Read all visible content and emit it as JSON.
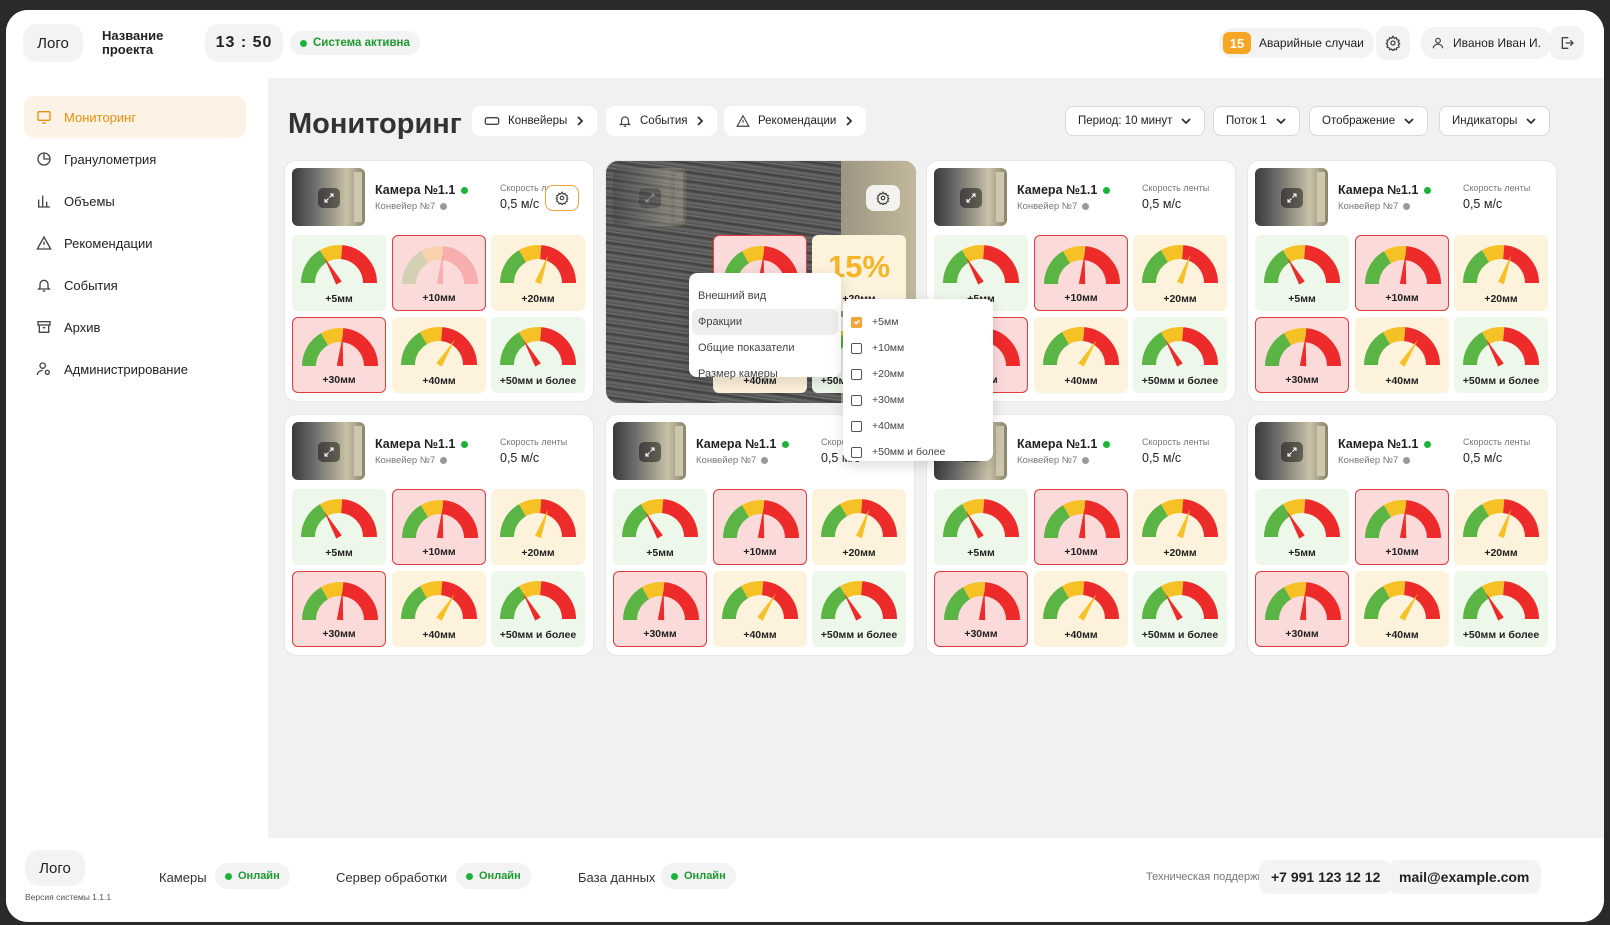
{
  "header": {
    "logo": "Лого",
    "project_name": "Название проекта",
    "clock": "13 : 50",
    "system_status": "Система активна",
    "alarm_count": "15",
    "alarm_label": "Аварийные случаи",
    "user_name": "Иванов Иван И."
  },
  "sidebar": {
    "items": [
      {
        "label": "Мониторинг",
        "icon": "monitor-icon"
      },
      {
        "label": "Гранулометрия",
        "icon": "pie-chart-icon"
      },
      {
        "label": "Объемы",
        "icon": "bar-chart-icon"
      },
      {
        "label": "Рекомендации",
        "icon": "warning-icon"
      },
      {
        "label": "События",
        "icon": "bell-icon"
      },
      {
        "label": "Архив",
        "icon": "archive-icon"
      },
      {
        "label": "Администрирование",
        "icon": "admin-user-icon"
      }
    ]
  },
  "toolbar": {
    "title": "Мониторинг",
    "tabs": [
      {
        "label": "Конвейеры",
        "icon": "conveyor-icon"
      },
      {
        "label": "События",
        "icon": "bell-icon"
      },
      {
        "label": "Рекомендации",
        "icon": "warning-icon"
      }
    ],
    "filters": [
      "Период: 10 минут",
      "Поток 1",
      "Отображение",
      "Индикаторы"
    ]
  },
  "camera": {
    "title": "Камера №1.1",
    "conveyor": "Конвейер №7",
    "speed_label": "Скорость ленты",
    "speed_value": "0,5 м/с"
  },
  "fractions": [
    {
      "label": "+5мм",
      "status": "green",
      "needle_deg": 60
    },
    {
      "label": "+10мм",
      "status": "red",
      "needle_deg": 95
    },
    {
      "label": "+20мм",
      "status": "yellow",
      "needle_deg": 110
    },
    {
      "label": "+30мм",
      "status": "red",
      "needle_deg": 95
    },
    {
      "label": "+40мм",
      "status": "yellow",
      "needle_deg": 122
    },
    {
      "label": "+50мм и более",
      "status": "green",
      "needle_deg": 60
    }
  ],
  "highlight_value": "15%",
  "settings_menu": {
    "items": [
      "Внешний вид",
      "Фракции",
      "Общие показатели",
      "Размер камеры"
    ],
    "selected": "Фракции"
  },
  "fractions_menu": {
    "items": [
      {
        "label": "+5мм",
        "checked": true
      },
      {
        "label": "+10мм",
        "checked": false
      },
      {
        "label": "+20мм",
        "checked": false
      },
      {
        "label": "+30мм",
        "checked": false
      },
      {
        "label": "+40мм",
        "checked": false
      },
      {
        "label": "+50мм и более",
        "checked": false
      }
    ]
  },
  "footer": {
    "logo": "Лого",
    "version": "Версия системы 1.1.1",
    "statuses": [
      {
        "label": "Камеры",
        "status": "Онлайн"
      },
      {
        "label": "Сервер обработки",
        "status": "Онлайн"
      },
      {
        "label": "База данных",
        "status": "Онлайн"
      }
    ],
    "support_label": "Техническая поддержка",
    "phone": "+7 991 123 12 12",
    "email": "mail@example.com"
  },
  "colors": {
    "accent": "#f0a43a",
    "online": "#1c9a2f",
    "gauge_green": "#5bb545",
    "gauge_yellow": "#f5c125",
    "gauge_red": "#ee2b2b"
  }
}
